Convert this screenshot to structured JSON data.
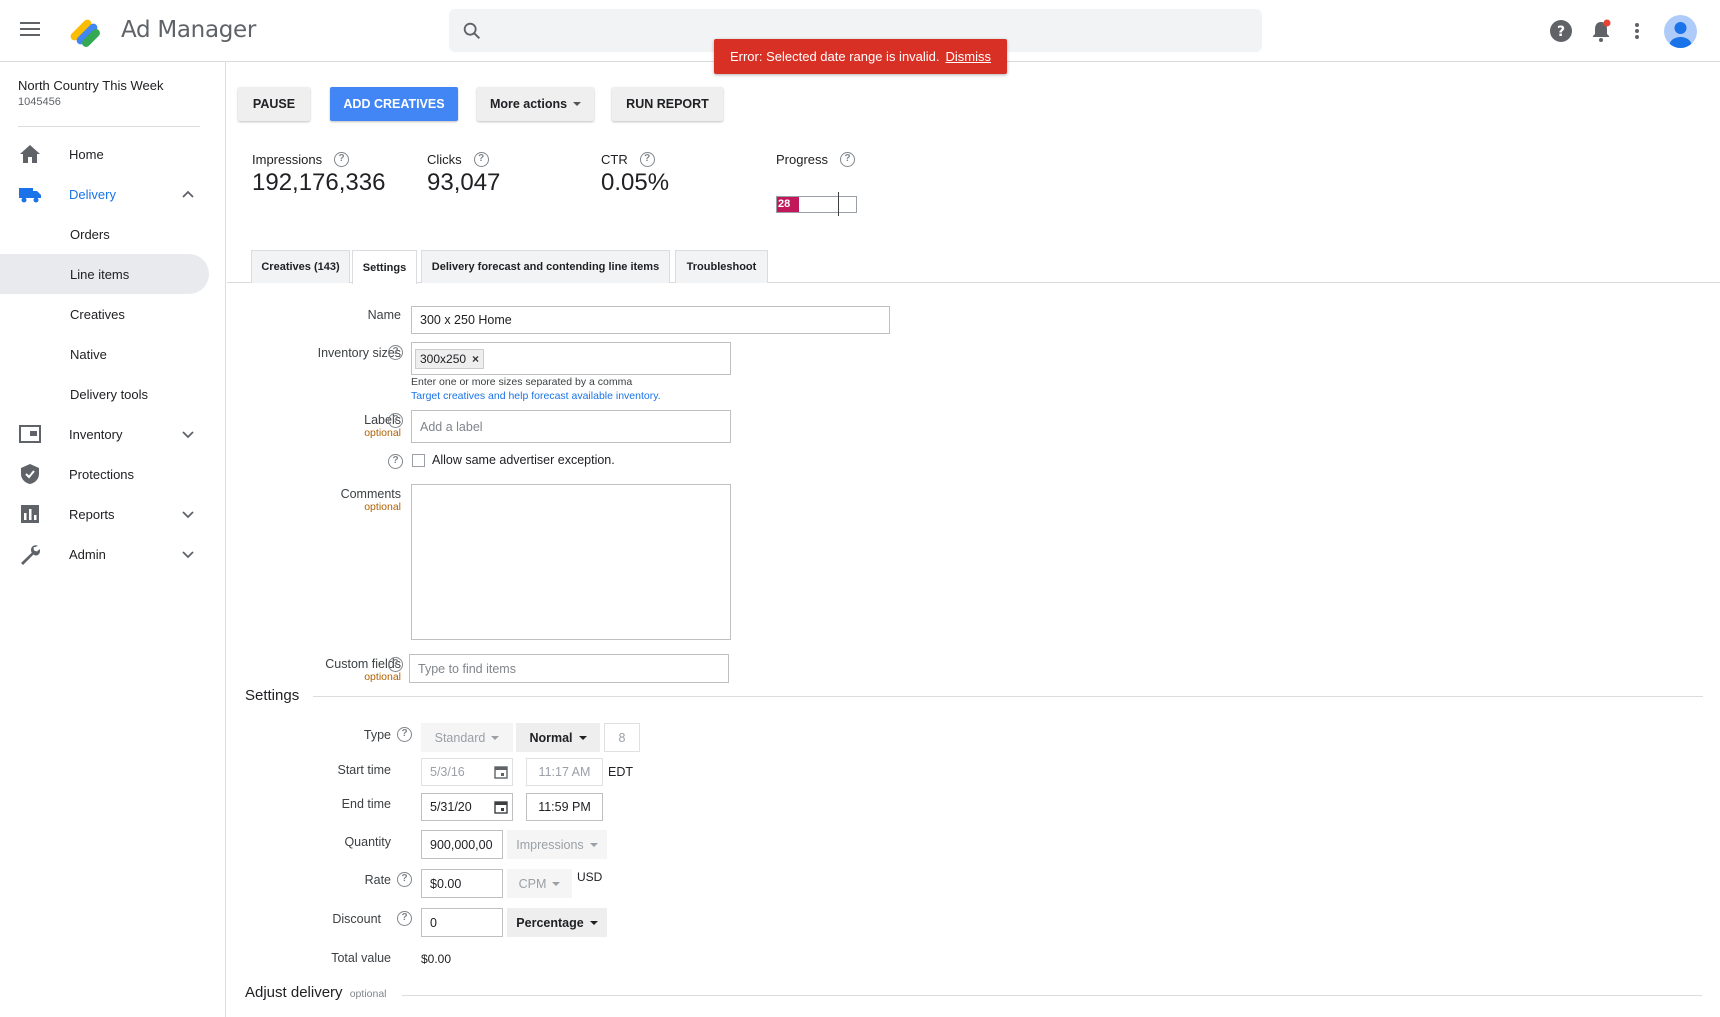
{
  "app": {
    "title": "Ad Manager"
  },
  "error": {
    "message": "Error: Selected date range is invalid.",
    "dismiss": "Dismiss"
  },
  "account": {
    "name": "North Country This Week",
    "id": "1045456"
  },
  "nav": {
    "home": "Home",
    "delivery": "Delivery",
    "orders": "Orders",
    "line_items": "Line items",
    "creatives": "Creatives",
    "native": "Native",
    "delivery_tools": "Delivery tools",
    "inventory": "Inventory",
    "protections": "Protections",
    "reports": "Reports",
    "admin": "Admin"
  },
  "toolbar": {
    "pause": "PAUSE",
    "add_creatives": "ADD CREATIVES",
    "more_actions": "More actions",
    "run_report": "RUN REPORT"
  },
  "stats": {
    "impressions_label": "Impressions",
    "impressions_value": "192,176,336",
    "clicks_label": "Clicks",
    "clicks_value": "93,047",
    "ctr_label": "CTR",
    "ctr_value": "0.05%",
    "progress_label": "Progress",
    "progress_value": "28",
    "progress_fraction": 0.28
  },
  "tabs": {
    "creatives": "Creatives (143)",
    "settings": "Settings",
    "forecast": "Delivery forecast and contending line items",
    "troubleshoot": "Troubleshoot"
  },
  "form": {
    "name_label": "Name",
    "name_value": "300 x 250 Home",
    "inventory_label": "Inventory sizes",
    "inventory_chip": "300x250",
    "inventory_hint": "Enter one or more sizes separated by a comma",
    "inventory_link": "Target creatives and help forecast available inventory.",
    "labels_label": "Labels",
    "optional": "optional",
    "labels_placeholder": "Add a label",
    "allow_exception": "Allow same advertiser exception.",
    "comments_label": "Comments",
    "custom_fields_label": "Custom fields",
    "custom_fields_placeholder": "Type to find items"
  },
  "settings": {
    "title": "Settings",
    "type_label": "Type",
    "type_value": "Standard",
    "priority_value": "Normal",
    "priority_number": "8",
    "start_label": "Start time",
    "start_date": "5/3/16",
    "start_time": "11:17 AM",
    "timezone": "EDT",
    "end_label": "End time",
    "end_date": "5/31/20",
    "end_time": "11:59 PM",
    "quantity_label": "Quantity",
    "quantity_value": "900,000,00",
    "quantity_unit": "Impressions",
    "rate_label": "Rate",
    "rate_value": "$0.00",
    "rate_unit": "CPM",
    "currency": "USD",
    "discount_label": "Discount",
    "discount_value": "0",
    "discount_type": "Percentage",
    "total_label": "Total value",
    "total_value": "$0.00"
  },
  "adjust": {
    "title": "Adjust delivery",
    "optional": "optional"
  },
  "colors": {
    "accent": "#4285f4",
    "error": "#d93025",
    "progress": "#c2185b",
    "link": "#1a73e8"
  }
}
